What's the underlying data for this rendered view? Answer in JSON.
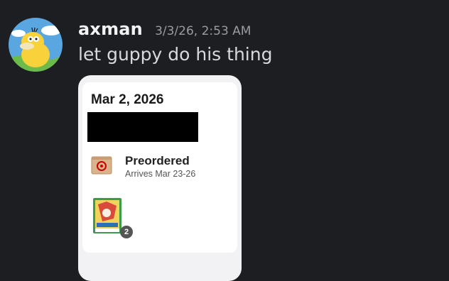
{
  "message": {
    "username": "axman",
    "timestamp": "3/3/26, 2:53 AM",
    "text": "let guppy do his thing",
    "avatar_icon": "psyduck-avatar"
  },
  "attachment": {
    "order_date": "Mar 2, 2026",
    "status_title": "Preordered",
    "status_subtitle": "Arrives Mar 23-26",
    "quantity_badge": "2",
    "box_icon": "target-box-icon",
    "product_icon": "trading-card-box-icon"
  },
  "colors": {
    "background": "#1d1e22",
    "username": "#f2f3f5",
    "timestamp": "#9b9ca3",
    "message_text": "#d7d9dc",
    "card_background": "#ffffff",
    "target_red": "#cc0000"
  }
}
